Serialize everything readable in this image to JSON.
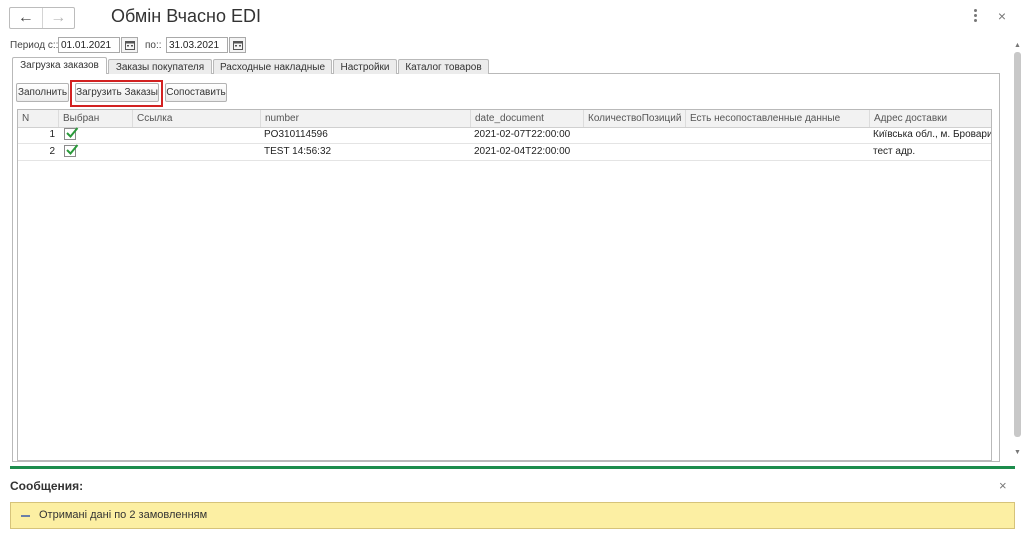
{
  "window": {
    "title": "Обмін Вчасно EDI",
    "back_icon": "←",
    "forward_icon": "→",
    "close_icon": "×"
  },
  "period": {
    "from_label": "Период с::",
    "from_value": "01.01.2021",
    "to_label": "по::",
    "to_value": "31.03.2021"
  },
  "tabs": [
    {
      "label": "Загрузка заказов",
      "active": true
    },
    {
      "label": "Заказы покупателя",
      "active": false
    },
    {
      "label": "Расходные накладные",
      "active": false
    },
    {
      "label": "Настройки",
      "active": false
    },
    {
      "label": "Каталог товаров",
      "active": false
    }
  ],
  "toolbar": {
    "fill_label": "Заполнить",
    "load_label": "Загрузить Заказы",
    "match_label": "Сопоставить"
  },
  "table": {
    "columns": [
      "N",
      "Выбран",
      "Ссылка",
      "number",
      "date_document",
      "КоличествоПозиций",
      "Есть несопоставленные данные",
      "Адрес доставки"
    ],
    "rows": [
      {
        "n": "1",
        "selected": true,
        "link": "",
        "number": "PO310114596",
        "date_document": "2021-02-07T22:00:00",
        "positions": "",
        "unmatched": "",
        "address": "Київська обл., м. Бровари,"
      },
      {
        "n": "2",
        "selected": true,
        "link": "",
        "number": "TEST 14:56:32",
        "date_document": "2021-02-04T22:00:00",
        "positions": "",
        "unmatched": "",
        "address": "тест адр."
      }
    ]
  },
  "messages": {
    "title": "Сообщения:",
    "close_icon": "×",
    "items": [
      "Отримані дані по 2 замовленням"
    ]
  },
  "colors": {
    "accent_green": "#1c8c4c",
    "message_bg": "#fcefa3",
    "highlight_red": "#d22121",
    "check_green": "#2a9a3a"
  }
}
